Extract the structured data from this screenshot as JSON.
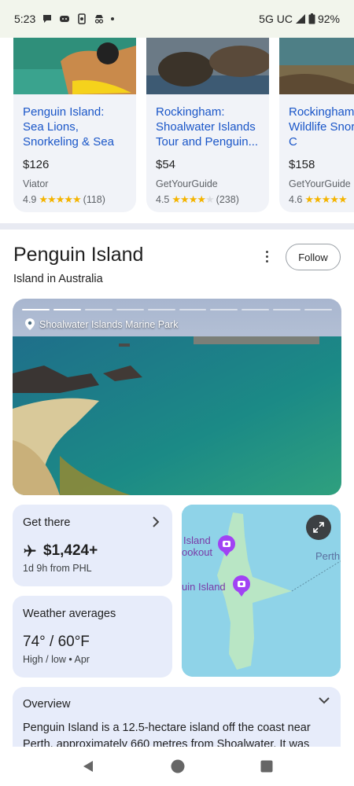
{
  "status_bar": {
    "time": "5:23",
    "network": "5G UC",
    "battery": "92%"
  },
  "tours": [
    {
      "title": "Penguin Island: Sea Lions, Snorkeling & Sea Kayaking...",
      "price": "$126",
      "source": "Viator",
      "rating": "4.9",
      "reviews": "(118)"
    },
    {
      "title": "Rockingham: Shoalwater Islands Tour and Penguin...",
      "price": "$54",
      "source": "GetYourGuide",
      "rating": "4.5",
      "reviews": "(238)"
    },
    {
      "title": "Rockingham Island Wildlife Snorkeling C",
      "price": "$158",
      "source": "GetYourGuide",
      "rating": "4.6",
      "reviews": ""
    }
  ],
  "place": {
    "title": "Penguin Island",
    "subtitle": "Island in Australia",
    "follow_label": "Follow"
  },
  "hero": {
    "location": "Shoalwater Islands Marine Park"
  },
  "get_there": {
    "title": "Get there",
    "price": "$1,424+",
    "detail": "1d 9h from PHL"
  },
  "weather": {
    "title": "Weather averages",
    "temps": "74° / 60°F",
    "detail": "High / low • Apr"
  },
  "map": {
    "label_top": "Island",
    "label_top2": "ookout",
    "label_main": "uin Island",
    "label_perth": "Perth"
  },
  "overview": {
    "title": "Overview",
    "text": "Penguin Island is a 12.5-hectare island off the coast near Perth, approximately 660 metres from Shoalwater. It was"
  }
}
